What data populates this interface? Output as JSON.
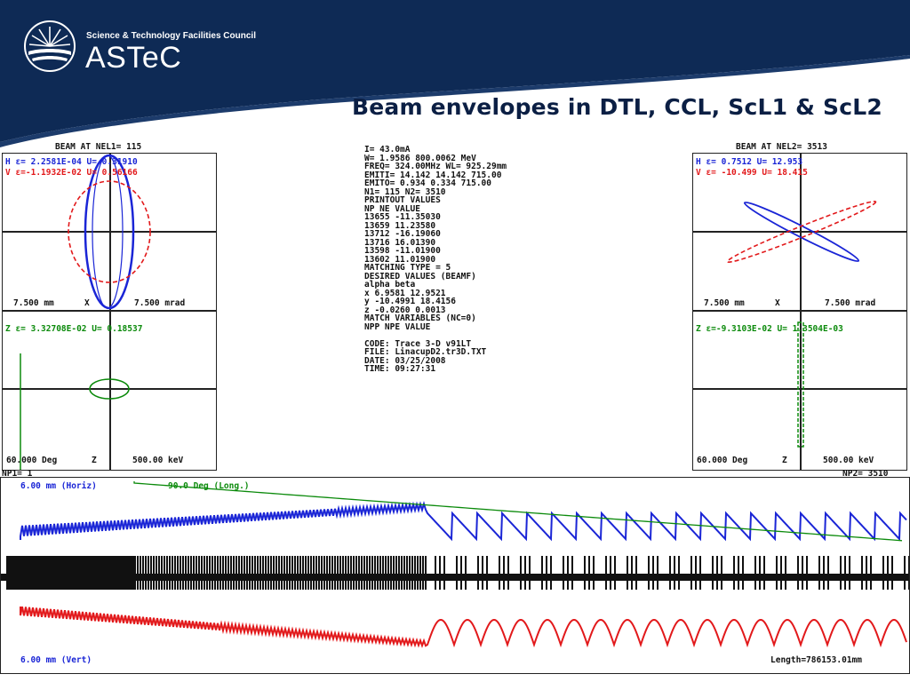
{
  "header": {
    "org_name": "Science & Technology Facilities Council",
    "brand": "ASTeC",
    "title": "Beam envelopes in DTL, CCL, ScL1 & ScL2",
    "bg_color": "#0e2a55"
  },
  "left_panel": {
    "caption": "BEAM AT NEL1=  115",
    "h_line": "H ε= 2.2581E-04   U= 0.31910",
    "v_line": "V ε=-1.1932E-02   U= 0.56166",
    "scale_left": "7.500 mm",
    "scale_mid": "X",
    "scale_right": "7.500 mrad",
    "z_line": "Z ε= 3.32708E-02   U= 0.18537",
    "bottom_left": "60.000 Deg",
    "bottom_mid": "Z",
    "bottom_right": "500.00 keV"
  },
  "right_panel": {
    "caption": "BEAM AT NEL2= 3513",
    "h_line": "H ε=  0.7512    U=  12.953",
    "v_line": "V ε= -10.499    U=  18.415",
    "scale_left": "7.500 mm",
    "scale_mid": "X",
    "scale_right": "7.500 mrad",
    "z_line": "Z ε=-9.3103E-02  U= 1.3504E-03",
    "bottom_left": "60.000 Deg",
    "bottom_mid": "Z",
    "bottom_right": "500.00 keV"
  },
  "center_block": [
    "I=     43.0mA",
    "W=   1.9586  800.0062 MeV",
    "FREQ= 324.00MHz   WL= 925.29mm",
    "EMITI=  14.142   14.142   715.00",
    "EMITO=   0.934    0.334   715.00",
    "N1=  115   N2= 3510",
    "PRINTOUT VALUES",
    "NP  NE       VALUE",
    "13655    -11.35030",
    "13659     11.23580",
    "13712    -16.19060",
    "13716     16.01390",
    "13598    -11.01900",
    "13602     11.01900",
    "MATCHING TYPE =  5",
    "DESIRED VALUES (BEAMF)",
    "  alpha      beta",
    "x   6.9581   12.9521",
    "y  -10.4991  18.4156",
    "z  -0.0260   0.0013",
    "MATCH VARIABLES (NC=0)",
    "NPP NPE     VALUE",
    "",
    "CODE:  Trace 3-D v91LT",
    "FILE:  LinacupD2.tr3D.TXT",
    "DATE:  03/25/2008",
    "TIME:  09:27:31"
  ],
  "lattice": {
    "label_nel1": "NP1=   1",
    "label_nel2": "NP2=  3510",
    "horiz_label": "6.00 mm (Horiz)",
    "phase_label": "90.0 Deg (Long.)",
    "vert_label": "6.00 mm (Vert)",
    "length_label": "Length=786153.01mm"
  },
  "colors": {
    "blue": "#1a25d6",
    "red": "#e2191b",
    "green": "#0b8a0b"
  }
}
